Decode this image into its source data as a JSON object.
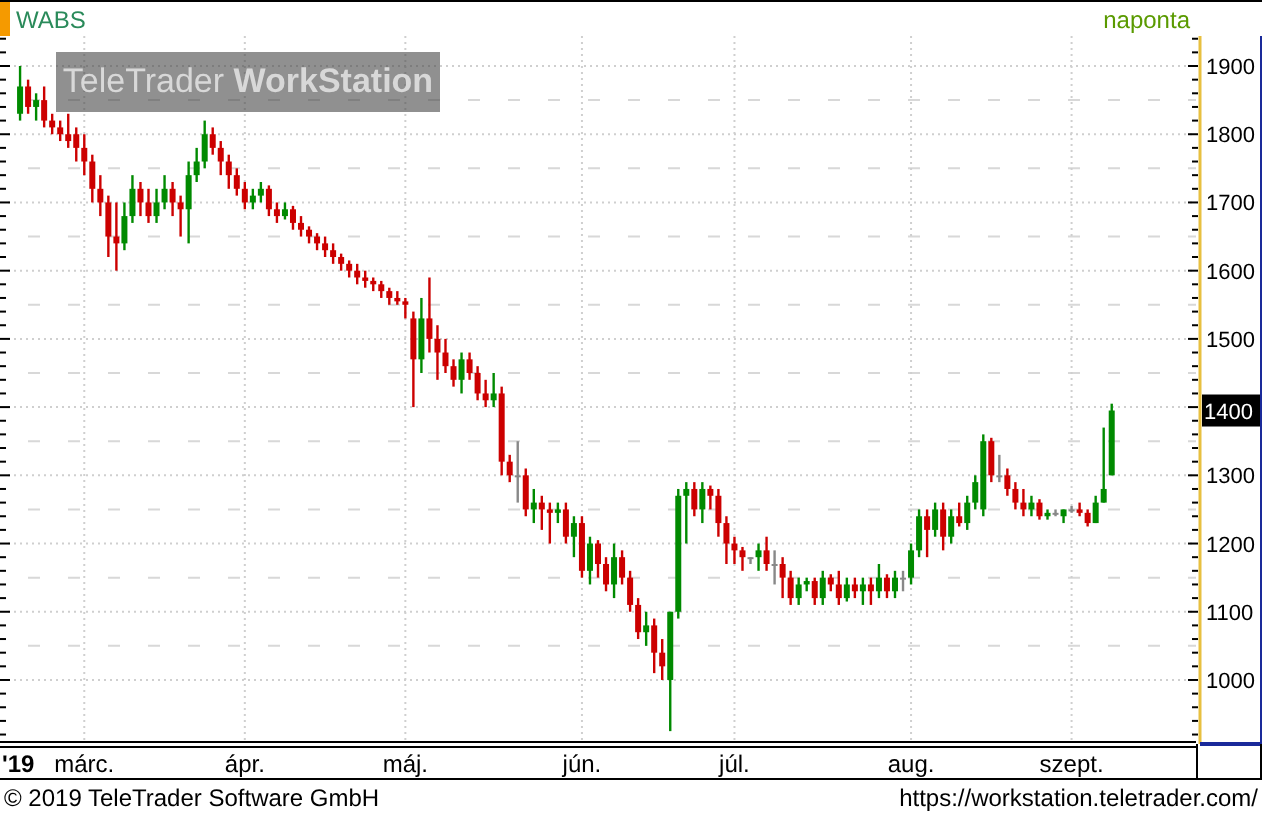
{
  "header": {
    "interval": "naponta"
  },
  "chart": {
    "watermark": "TeleTrader **WorkStation**",
    "last_price": "1400",
    "year_label": "'19",
    "chart_data": {
      "type": "candlestick",
      "grid": true,
      "categories": [
        null,
        null,
        null,
        null,
        null,
        null,
        null,
        null,
        "márc.",
        null,
        null,
        null,
        null,
        null,
        null,
        null,
        null,
        null,
        null,
        null,
        null,
        null,
        null,
        null,
        null,
        null,
        null,
        null,
        "ápr.",
        null,
        null,
        null,
        null,
        null,
        null,
        null,
        null,
        null,
        null,
        null,
        null,
        null,
        null,
        null,
        null,
        null,
        null,
        null,
        "máj.",
        null,
        null,
        null,
        null,
        null,
        null,
        null,
        null,
        null,
        null,
        null,
        null,
        null,
        null,
        null,
        null,
        null,
        null,
        null,
        null,
        null,
        "jún.",
        null,
        null,
        null,
        null,
        null,
        null,
        null,
        null,
        null,
        null,
        null,
        null,
        null,
        null,
        null,
        null,
        null,
        null,
        "júl.",
        null,
        null,
        null,
        null,
        null,
        null,
        null,
        null,
        null,
        null,
        null,
        null,
        null,
        null,
        null,
        null,
        null,
        null,
        null,
        null,
        null,
        "aug.",
        null,
        null,
        null,
        null,
        null,
        null,
        null,
        null,
        null,
        null,
        null,
        null,
        null,
        null,
        null,
        null,
        null,
        null,
        null,
        "szept.",
        null,
        null,
        null,
        null,
        null
      ],
      "ylim": [
        912,
        1944
      ],
      "yticks": [
        1000,
        1100,
        1200,
        1300,
        1400,
        1500,
        1600,
        1700,
        1800,
        1900
      ],
      "series": [
        {
          "name": "WABS",
          "ohlc": [
            [
              1830,
              1900,
              1820,
              1870
            ],
            [
              1870,
              1880,
              1830,
              1840
            ],
            [
              1840,
              1860,
              1820,
              1850
            ],
            [
              1850,
              1870,
              1810,
              1820
            ],
            [
              1820,
              1830,
              1800,
              1810
            ],
            [
              1810,
              1820,
              1790,
              1800
            ],
            [
              1800,
              1830,
              1780,
              1790
            ],
            [
              1800,
              1810,
              1760,
              1780
            ],
            [
              1780,
              1800,
              1740,
              1760
            ],
            [
              1760,
              1770,
              1700,
              1720
            ],
            [
              1720,
              1740,
              1680,
              1700
            ],
            [
              1700,
              1710,
              1620,
              1650
            ],
            [
              1650,
              1700,
              1600,
              1640
            ],
            [
              1640,
              1700,
              1630,
              1680
            ],
            [
              1680,
              1740,
              1670,
              1720
            ],
            [
              1720,
              1730,
              1680,
              1700
            ],
            [
              1700,
              1720,
              1670,
              1680
            ],
            [
              1680,
              1720,
              1670,
              1700
            ],
            [
              1700,
              1740,
              1690,
              1720
            ],
            [
              1720,
              1730,
              1680,
              1700
            ],
            [
              1700,
              1710,
              1650,
              1690
            ],
            [
              1690,
              1760,
              1640,
              1740
            ],
            [
              1740,
              1780,
              1730,
              1760
            ],
            [
              1760,
              1820,
              1750,
              1800
            ],
            [
              1800,
              1810,
              1770,
              1780
            ],
            [
              1780,
              1790,
              1740,
              1760
            ],
            [
              1760,
              1770,
              1720,
              1740
            ],
            [
              1740,
              1750,
              1710,
              1720
            ],
            [
              1720,
              1730,
              1690,
              1700
            ],
            [
              1700,
              1720,
              1690,
              1710
            ],
            [
              1710,
              1730,
              1700,
              1720
            ],
            [
              1720,
              1725,
              1680,
              1690
            ],
            [
              1690,
              1700,
              1670,
              1680
            ],
            [
              1680,
              1700,
              1675,
              1690
            ],
            [
              1690,
              1695,
              1660,
              1670
            ],
            [
              1670,
              1680,
              1650,
              1660
            ],
            [
              1660,
              1665,
              1640,
              1650
            ],
            [
              1650,
              1655,
              1630,
              1640
            ],
            [
              1640,
              1650,
              1620,
              1630
            ],
            [
              1630,
              1640,
              1610,
              1620
            ],
            [
              1620,
              1625,
              1600,
              1610
            ],
            [
              1610,
              1615,
              1590,
              1600
            ],
            [
              1600,
              1610,
              1580,
              1590
            ],
            [
              1590,
              1600,
              1575,
              1585
            ],
            [
              1585,
              1590,
              1570,
              1580
            ],
            [
              1580,
              1585,
              1560,
              1570
            ],
            [
              1570,
              1575,
              1550,
              1560
            ],
            [
              1560,
              1570,
              1550,
              1555
            ],
            [
              1555,
              1560,
              1530,
              1550
            ],
            [
              1530,
              1540,
              1400,
              1470
            ],
            [
              1470,
              1560,
              1450,
              1530
            ],
            [
              1530,
              1590,
              1480,
              1500
            ],
            [
              1500,
              1520,
              1440,
              1480
            ],
            [
              1480,
              1500,
              1450,
              1460
            ],
            [
              1460,
              1470,
              1430,
              1440
            ],
            [
              1440,
              1480,
              1420,
              1470
            ],
            [
              1470,
              1480,
              1440,
              1450
            ],
            [
              1450,
              1460,
              1410,
              1420
            ],
            [
              1420,
              1440,
              1400,
              1410
            ],
            [
              1410,
              1450,
              1400,
              1420
            ],
            [
              1420,
              1430,
              1300,
              1320
            ],
            [
              1320,
              1330,
              1290,
              1300
            ],
            [
              1300,
              1350,
              1260,
              1300
            ],
            [
              1300,
              1310,
              1240,
              1250
            ],
            [
              1250,
              1280,
              1230,
              1260
            ],
            [
              1260,
              1270,
              1220,
              1250
            ],
            [
              1250,
              1260,
              1200,
              1245
            ],
            [
              1245,
              1260,
              1230,
              1250
            ],
            [
              1250,
              1260,
              1200,
              1210
            ],
            [
              1210,
              1240,
              1180,
              1230
            ],
            [
              1230,
              1240,
              1150,
              1160
            ],
            [
              1160,
              1210,
              1140,
              1200
            ],
            [
              1200,
              1205,
              1150,
              1170
            ],
            [
              1170,
              1180,
              1130,
              1140
            ],
            [
              1140,
              1200,
              1120,
              1180
            ],
            [
              1180,
              1190,
              1140,
              1150
            ],
            [
              1150,
              1160,
              1100,
              1110
            ],
            [
              1110,
              1120,
              1060,
              1070
            ],
            [
              1070,
              1100,
              1050,
              1080
            ],
            [
              1080,
              1090,
              1010,
              1040
            ],
            [
              1040,
              1060,
              1000,
              1020
            ],
            [
              1000,
              1100,
              925,
              1100
            ],
            [
              1100,
              1280,
              1090,
              1270
            ],
            [
              1270,
              1290,
              1200,
              1280
            ],
            [
              1280,
              1290,
              1240,
              1250
            ],
            [
              1250,
              1290,
              1230,
              1280
            ],
            [
              1280,
              1285,
              1250,
              1270
            ],
            [
              1270,
              1280,
              1210,
              1230
            ],
            [
              1230,
              1240,
              1170,
              1200
            ],
            [
              1200,
              1210,
              1170,
              1190
            ],
            [
              1190,
              1195,
              1160,
              1180
            ],
            [
              1180,
              1180,
              1170,
              1180
            ],
            [
              1180,
              1200,
              1160,
              1190
            ],
            [
              1190,
              1210,
              1160,
              1170
            ],
            [
              1170,
              1190,
              1140,
              1170
            ],
            [
              1170,
              1180,
              1120,
              1150
            ],
            [
              1150,
              1160,
              1110,
              1120
            ],
            [
              1120,
              1150,
              1110,
              1140
            ],
            [
              1140,
              1150,
              1130,
              1145
            ],
            [
              1145,
              1150,
              1110,
              1120
            ],
            [
              1120,
              1160,
              1110,
              1150
            ],
            [
              1150,
              1155,
              1130,
              1140
            ],
            [
              1140,
              1160,
              1110,
              1120
            ],
            [
              1120,
              1150,
              1115,
              1140
            ],
            [
              1140,
              1150,
              1120,
              1130
            ],
            [
              1130,
              1150,
              1110,
              1140
            ],
            [
              1140,
              1150,
              1110,
              1130
            ],
            [
              1130,
              1170,
              1120,
              1150
            ],
            [
              1150,
              1155,
              1120,
              1130
            ],
            [
              1130,
              1160,
              1120,
              1150
            ],
            [
              1150,
              1160,
              1130,
              1150
            ],
            [
              1150,
              1200,
              1140,
              1190
            ],
            [
              1190,
              1250,
              1180,
              1240
            ],
            [
              1240,
              1250,
              1180,
              1220
            ],
            [
              1220,
              1260,
              1210,
              1250
            ],
            [
              1250,
              1260,
              1190,
              1210
            ],
            [
              1210,
              1250,
              1200,
              1240
            ],
            [
              1240,
              1260,
              1225,
              1230
            ],
            [
              1230,
              1270,
              1220,
              1260
            ],
            [
              1260,
              1300,
              1250,
              1290
            ],
            [
              1250,
              1360,
              1240,
              1350
            ],
            [
              1350,
              1355,
              1290,
              1300
            ],
            [
              1300,
              1330,
              1290,
              1300
            ],
            [
              1300,
              1310,
              1270,
              1280
            ],
            [
              1280,
              1290,
              1250,
              1260
            ],
            [
              1260,
              1280,
              1240,
              1250
            ],
            [
              1250,
              1270,
              1240,
              1260
            ],
            [
              1260,
              1265,
              1235,
              1240
            ],
            [
              1240,
              1250,
              1235,
              1245
            ],
            [
              1245,
              1250,
              1240,
              1245
            ],
            [
              1240,
              1250,
              1230,
              1250
            ],
            [
              1250,
              1255,
              1245,
              1250
            ],
            [
              1250,
              1260,
              1240,
              1245
            ],
            [
              1245,
              1250,
              1225,
              1230
            ],
            [
              1230,
              1270,
              1230,
              1260
            ],
            [
              1260,
              1370,
              1260,
              1280
            ],
            [
              1300,
              1405,
              1300,
              1395
            ]
          ]
        }
      ]
    }
  },
  "footer": {
    "copyright": "© 2019 TeleTrader Software GmbH",
    "url": "https://workstation.teletrader.com/"
  }
}
